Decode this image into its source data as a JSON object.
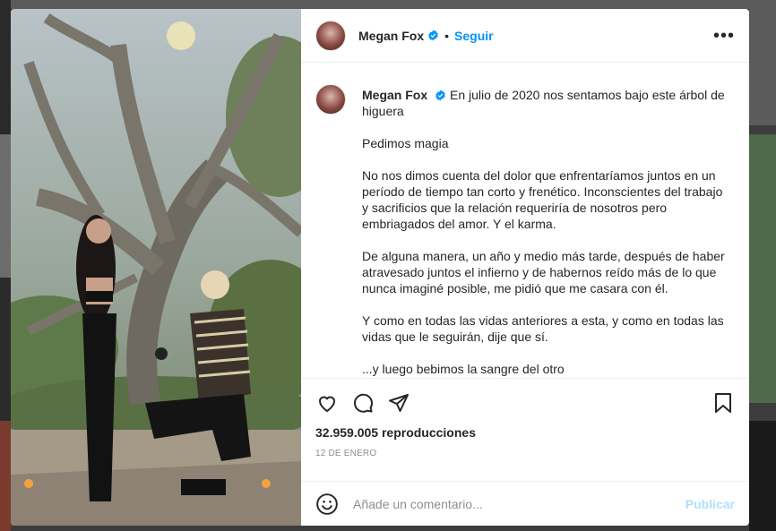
{
  "post": {
    "username": "Megan Fox",
    "follow_label": "Seguir",
    "separator": "•",
    "more_label": "•••"
  },
  "caption": {
    "username": "Megan Fox",
    "paragraphs": [
      "En julio de 2020 nos sentamos bajo este árbol de higuera",
      "Pedimos magia",
      "No nos dimos cuenta del dolor que enfrentaríamos juntos en un período de tiempo tan corto y frenético. Inconscientes del trabajo y sacrificios que la relación requeriría de nosotros pero embriagados del amor. Y el karma.",
      "De alguna manera, un año y medio más tarde, después de haber atravesado juntos el infierno y de habernos reído más de lo que nunca imaginé posible, me pidió que me casara con él.",
      "Y como en todas las vidas anteriores a esta, y como en todas las vidas que le seguirán, dije que sí.",
      "...y luego bebimos la sangre del otro"
    ]
  },
  "stats": {
    "views": "32.959.005 reproducciones",
    "date": "12 DE ENERO"
  },
  "comment": {
    "placeholder": "Añade un comentario...",
    "publish_label": "Publicar"
  },
  "colors": {
    "accent": "#0095f6",
    "publish_disabled": "#b2dffc"
  }
}
